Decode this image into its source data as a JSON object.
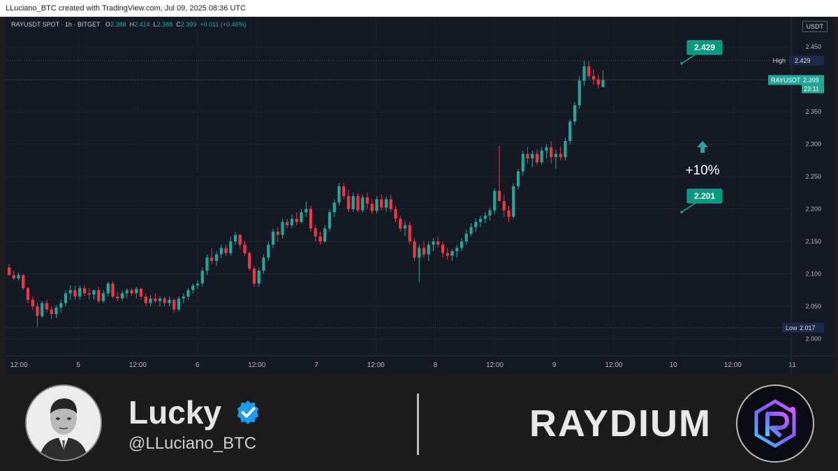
{
  "attribution": "LLuciano_BTC created with TradingView.com, Jul 09, 2025 08:36 UTC",
  "symbol_line": {
    "symbol": "RAYUSDT SPOT · 1h · BITGET",
    "o_label": "O",
    "o": "2.388",
    "h_label": "H",
    "h": "2.414",
    "l_label": "L",
    "l": "2.388",
    "c_label": "C",
    "c": "2.399",
    "change": "+0.011 (+0.46%)"
  },
  "currency_box": "USDT",
  "chart_data": {
    "type": "candlestick",
    "ylim": [
      1.98,
      2.475
    ],
    "y_ticks": [
      "2.000",
      "2.050",
      "2.100",
      "2.150",
      "2.200",
      "2.250",
      "2.300",
      "2.350",
      "2.400",
      "2.450"
    ],
    "x_ticks": [
      "12:00",
      "5",
      "12:00",
      "6",
      "12:00",
      "7",
      "12:00",
      "8",
      "12:00",
      "9",
      "12:00",
      "10",
      "12:00",
      "11"
    ],
    "high_label": "High",
    "high_value": "2.429",
    "low_label": "Low",
    "low_value": "2.017",
    "last_label": "RAYUSDT",
    "last_value": "2.399",
    "countdown": "23:11",
    "annotations": {
      "top_callout": "2.429",
      "bottom_callout": "2.201",
      "change_pct": "+10%"
    },
    "colors": {
      "up": "#26a69a",
      "down": "#f23645",
      "background": "#151924"
    },
    "candles": [
      [
        2.11,
        2.115,
        2.098,
        2.098
      ],
      [
        2.098,
        2.105,
        2.09,
        2.093
      ],
      [
        2.093,
        2.102,
        2.09,
        2.098
      ],
      [
        2.098,
        2.1,
        2.075,
        2.078
      ],
      [
        2.078,
        2.08,
        2.055,
        2.06
      ],
      [
        2.06,
        2.065,
        2.045,
        2.05
      ],
      [
        2.05,
        2.056,
        2.018,
        2.035
      ],
      [
        2.035,
        2.058,
        2.032,
        2.055
      ],
      [
        2.055,
        2.06,
        2.04,
        2.045
      ],
      [
        2.045,
        2.05,
        2.03,
        2.038
      ],
      [
        2.038,
        2.052,
        2.032,
        2.048
      ],
      [
        2.048,
        2.06,
        2.04,
        2.055
      ],
      [
        2.055,
        2.075,
        2.05,
        2.07
      ],
      [
        2.07,
        2.082,
        2.06,
        2.075
      ],
      [
        2.075,
        2.082,
        2.06,
        2.065
      ],
      [
        2.065,
        2.082,
        2.06,
        2.078
      ],
      [
        2.078,
        2.082,
        2.066,
        2.07
      ],
      [
        2.07,
        2.078,
        2.06,
        2.068
      ],
      [
        2.068,
        2.075,
        2.06,
        2.075
      ],
      [
        2.075,
        2.08,
        2.055,
        2.058
      ],
      [
        2.058,
        2.075,
        2.055,
        2.07
      ],
      [
        2.07,
        2.088,
        2.065,
        2.085
      ],
      [
        2.085,
        2.088,
        2.062,
        2.065
      ],
      [
        2.065,
        2.072,
        2.058,
        2.062
      ],
      [
        2.062,
        2.075,
        2.058,
        2.07
      ],
      [
        2.07,
        2.078,
        2.062,
        2.075
      ],
      [
        2.075,
        2.078,
        2.066,
        2.07
      ],
      [
        2.07,
        2.08,
        2.062,
        2.077
      ],
      [
        2.077,
        2.079,
        2.06,
        2.065
      ],
      [
        2.065,
        2.07,
        2.05,
        2.055
      ],
      [
        2.055,
        2.068,
        2.05,
        2.062
      ],
      [
        2.062,
        2.07,
        2.055,
        2.058
      ],
      [
        2.058,
        2.066,
        2.05,
        2.062
      ],
      [
        2.062,
        2.065,
        2.05,
        2.055
      ],
      [
        2.055,
        2.065,
        2.05,
        2.06
      ],
      [
        2.06,
        2.062,
        2.04,
        2.045
      ],
      [
        2.045,
        2.065,
        2.042,
        2.062
      ],
      [
        2.062,
        2.07,
        2.055,
        2.065
      ],
      [
        2.065,
        2.078,
        2.06,
        2.075
      ],
      [
        2.075,
        2.085,
        2.07,
        2.082
      ],
      [
        2.082,
        2.09,
        2.076,
        2.085
      ],
      [
        2.085,
        2.11,
        2.08,
        2.105
      ],
      [
        2.105,
        2.13,
        2.098,
        2.125
      ],
      [
        2.125,
        2.14,
        2.115,
        2.12
      ],
      [
        2.12,
        2.135,
        2.112,
        2.13
      ],
      [
        2.13,
        2.145,
        2.125,
        2.14
      ],
      [
        2.14,
        2.145,
        2.128,
        2.132
      ],
      [
        2.132,
        2.158,
        2.128,
        2.15
      ],
      [
        2.15,
        2.165,
        2.145,
        2.16
      ],
      [
        2.16,
        2.162,
        2.14,
        2.145
      ],
      [
        2.145,
        2.15,
        2.128,
        2.132
      ],
      [
        2.132,
        2.135,
        2.105,
        2.108
      ],
      [
        2.108,
        2.112,
        2.08,
        2.085
      ],
      [
        2.085,
        2.11,
        2.08,
        2.105
      ],
      [
        2.105,
        2.13,
        2.1,
        2.125
      ],
      [
        2.125,
        2.15,
        2.12,
        2.145
      ],
      [
        2.145,
        2.17,
        2.14,
        2.165
      ],
      [
        2.165,
        2.172,
        2.15,
        2.16
      ],
      [
        2.16,
        2.185,
        2.155,
        2.18
      ],
      [
        2.18,
        2.185,
        2.17,
        2.175
      ],
      [
        2.175,
        2.192,
        2.17,
        2.185
      ],
      [
        2.185,
        2.195,
        2.175,
        2.18
      ],
      [
        2.18,
        2.2,
        2.178,
        2.195
      ],
      [
        2.195,
        2.212,
        2.188,
        2.2
      ],
      [
        2.2,
        2.205,
        2.165,
        2.17
      ],
      [
        2.17,
        2.175,
        2.15,
        2.158
      ],
      [
        2.158,
        2.165,
        2.145,
        2.15
      ],
      [
        2.15,
        2.175,
        2.148,
        2.17
      ],
      [
        2.17,
        2.2,
        2.165,
        2.195
      ],
      [
        2.195,
        2.215,
        2.188,
        2.21
      ],
      [
        2.21,
        2.24,
        2.205,
        2.235
      ],
      [
        2.235,
        2.24,
        2.215,
        2.22
      ],
      [
        2.22,
        2.23,
        2.195,
        2.2
      ],
      [
        2.2,
        2.225,
        2.195,
        2.22
      ],
      [
        2.22,
        2.225,
        2.195,
        2.198
      ],
      [
        2.198,
        2.222,
        2.195,
        2.218
      ],
      [
        2.218,
        2.225,
        2.2,
        2.208
      ],
      [
        2.208,
        2.215,
        2.192,
        2.197
      ],
      [
        2.197,
        2.22,
        2.193,
        2.215
      ],
      [
        2.215,
        2.222,
        2.198,
        2.202
      ],
      [
        2.202,
        2.22,
        2.195,
        2.215
      ],
      [
        2.215,
        2.222,
        2.195,
        2.2
      ],
      [
        2.2,
        2.205,
        2.18,
        2.185
      ],
      [
        2.185,
        2.19,
        2.165,
        2.17
      ],
      [
        2.17,
        2.182,
        2.158,
        2.175
      ],
      [
        2.175,
        2.18,
        2.145,
        2.15
      ],
      [
        2.15,
        2.155,
        2.12,
        2.125
      ],
      [
        2.125,
        2.145,
        2.088,
        2.14
      ],
      [
        2.14,
        2.15,
        2.125,
        2.13
      ],
      [
        2.13,
        2.15,
        2.12,
        2.145
      ],
      [
        2.145,
        2.155,
        2.135,
        2.15
      ],
      [
        2.15,
        2.158,
        2.14,
        2.145
      ],
      [
        2.145,
        2.15,
        2.125,
        2.132
      ],
      [
        2.132,
        2.14,
        2.122,
        2.128
      ],
      [
        2.128,
        2.138,
        2.12,
        2.135
      ],
      [
        2.135,
        2.145,
        2.125,
        2.14
      ],
      [
        2.14,
        2.155,
        2.135,
        2.15
      ],
      [
        2.15,
        2.168,
        2.145,
        2.162
      ],
      [
        2.162,
        2.178,
        2.158,
        2.172
      ],
      [
        2.172,
        2.185,
        2.165,
        2.18
      ],
      [
        2.18,
        2.19,
        2.172,
        2.185
      ],
      [
        2.185,
        2.195,
        2.178,
        2.19
      ],
      [
        2.19,
        2.202,
        2.182,
        2.198
      ],
      [
        2.198,
        2.232,
        2.192,
        2.228
      ],
      [
        2.228,
        2.298,
        2.22,
        2.212
      ],
      [
        2.212,
        2.222,
        2.188,
        2.198
      ],
      [
        2.198,
        2.205,
        2.18,
        2.188
      ],
      [
        2.188,
        2.24,
        2.185,
        2.235
      ],
      [
        2.235,
        2.262,
        2.23,
        2.258
      ],
      [
        2.258,
        2.29,
        2.252,
        2.285
      ],
      [
        2.285,
        2.296,
        2.27,
        2.278
      ],
      [
        2.278,
        2.29,
        2.265,
        2.285
      ],
      [
        2.285,
        2.292,
        2.268,
        2.272
      ],
      [
        2.272,
        2.296,
        2.268,
        2.29
      ],
      [
        2.29,
        2.3,
        2.278,
        2.295
      ],
      [
        2.295,
        2.305,
        2.27,
        2.28
      ],
      [
        2.28,
        2.292,
        2.262,
        2.285
      ],
      [
        2.285,
        2.296,
        2.275,
        2.28
      ],
      [
        2.28,
        2.31,
        2.275,
        2.305
      ],
      [
        2.305,
        2.338,
        2.3,
        2.335
      ],
      [
        2.335,
        2.365,
        2.33,
        2.36
      ],
      [
        2.36,
        2.405,
        2.355,
        2.398
      ],
      [
        2.398,
        2.429,
        2.39,
        2.42
      ],
      [
        2.42,
        2.428,
        2.4,
        2.405
      ],
      [
        2.405,
        2.415,
        2.392,
        2.4
      ],
      [
        2.4,
        2.408,
        2.386,
        2.392
      ],
      [
        2.388,
        2.414,
        2.388,
        2.399
      ]
    ]
  },
  "footer": {
    "name": "Lucky",
    "handle": "@LLuciano_BTC",
    "brand": "RAYDIUM"
  }
}
